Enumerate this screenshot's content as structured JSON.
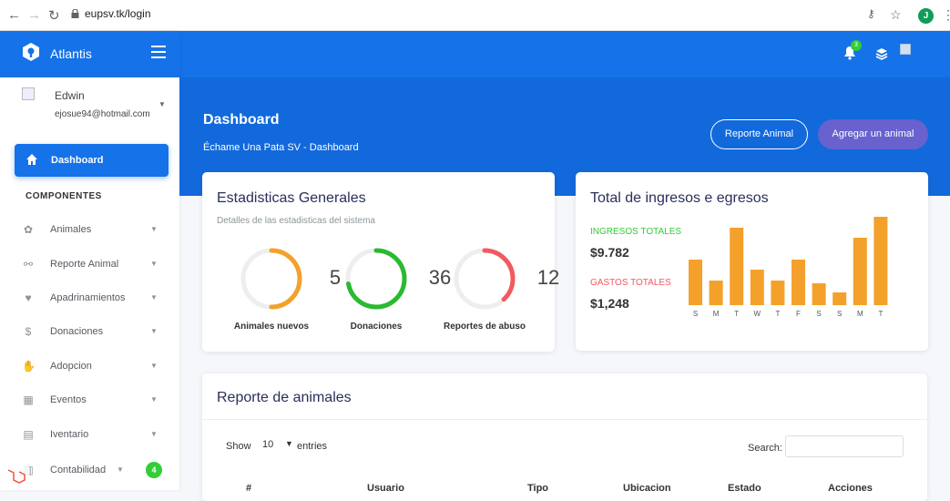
{
  "browser": {
    "url": "eupsv.tk/login",
    "profile_initial": "J"
  },
  "sidebar": {
    "brand": "Atlantis",
    "user": {
      "name": "Edwin",
      "email": "ejosue94@hotmail.com"
    },
    "active_item": "Dashboard",
    "section_title": "COMPONENTES",
    "items": [
      {
        "label": "Animales",
        "icon": "paw-icon"
      },
      {
        "label": "Reporte Animal",
        "icon": "bone-icon"
      },
      {
        "label": "Apadrinamientos",
        "icon": "user-heart-icon"
      },
      {
        "label": "Donaciones",
        "icon": "dollar-icon"
      },
      {
        "label": "Adopcion",
        "icon": "handshake-icon"
      },
      {
        "label": "Eventos",
        "icon": "calendar-icon"
      },
      {
        "label": "Iventario",
        "icon": "book-icon"
      },
      {
        "label": "Contabilidad",
        "icon": "ledger-icon",
        "badge": "4"
      }
    ]
  },
  "topbar": {
    "notification_count": "3"
  },
  "header": {
    "title": "Dashboard",
    "subtitle": "Échame Una Pata SV - Dashboard",
    "btn_report": "Reporte Animal",
    "btn_add": "Agregar un animal"
  },
  "stats": {
    "title": "Estadisticas Generales",
    "subtitle": "Detalles de las estadisticas del sistema",
    "circles": [
      {
        "value": "5",
        "label": "Animales nuevos",
        "color": "#f3a12b",
        "fraction": 0.5
      },
      {
        "value": "36",
        "label": "Donaciones",
        "color": "#2bb930",
        "fraction": 0.72
      },
      {
        "value": "12",
        "label": "Reportes de abuso",
        "color": "#f25961",
        "fraction": 0.38
      }
    ]
  },
  "income": {
    "title": "Total de ingresos e egresos",
    "ingresos_label": "INGRESOS TOTALES",
    "ingresos_value": "$9.782",
    "gastos_label": "GASTOS TOTALES",
    "gastos_value": "$1,248"
  },
  "chart_data": {
    "type": "bar",
    "categories": [
      "S",
      "M",
      "T",
      "W",
      "T",
      "F",
      "S",
      "S",
      "M",
      "T"
    ],
    "values": [
      50,
      27,
      85,
      39,
      27,
      50,
      24,
      14,
      74,
      97
    ],
    "ylim": [
      0,
      100
    ],
    "color": "#f3a12b",
    "grid": false
  },
  "report": {
    "title": "Reporte de animales",
    "show_label": "Show",
    "entries_value": "10",
    "entries_label": "entries",
    "search_label": "Search:",
    "columns": [
      "#",
      "Usuario",
      "Tipo",
      "Ubicacion",
      "Estado",
      "Acciones"
    ]
  }
}
